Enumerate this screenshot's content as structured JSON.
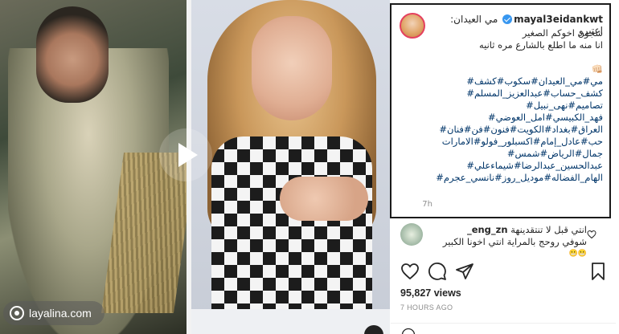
{
  "post": {
    "username": "mayal3eidankwt",
    "caption_lines": [
      "مي العيدان: اعتبرو",
      "شجون اخوكم الصغير",
      "انا منه ما اطلع بالشارع مره ثانيه"
    ],
    "caption_emoji": "👊🏻",
    "hashtag_lines": [
      "مي#مي_العيدان#سكوب#كشف#",
      "كشف_حساب#عبدالعزيز_المسلم#",
      "تصاميم#نهى_نبيل#",
      "فهد_الكبيسي#امل_العوضي#",
      "العراق#بغداد#الكويت#فنون#فن#فنان#",
      "حب#عادل_إمام#اكسبلور_فولو#الامارات",
      "جمال#الرياض#شمس#",
      "عبدالحسين_عبدالرضا#شيماءعلي#",
      "الهام_الفضاله#موديل_روز#نانسي_عجرم#"
    ],
    "time_ago": "7h"
  },
  "comment": {
    "username": "eng_zn_",
    "text_line1": "انتي قبل لا تنتقدينهة",
    "text_line2": "شوفي روحج بالمراية انتي اخونا الكبير",
    "emoji": "😬😬"
  },
  "stats": {
    "views": "95,827 views",
    "posted": "7 HOURS AGO"
  },
  "watermark": {
    "text": "layalina.com"
  },
  "icons": {
    "play": "play-icon",
    "like": "heart-icon",
    "comment": "comment-icon",
    "share": "paper-plane-icon",
    "save": "bookmark-icon",
    "verified": "verified-badge-icon"
  },
  "colors": {
    "hashtag": "#003569",
    "verified": "#3897f0",
    "muted": "#8e8e8e"
  }
}
